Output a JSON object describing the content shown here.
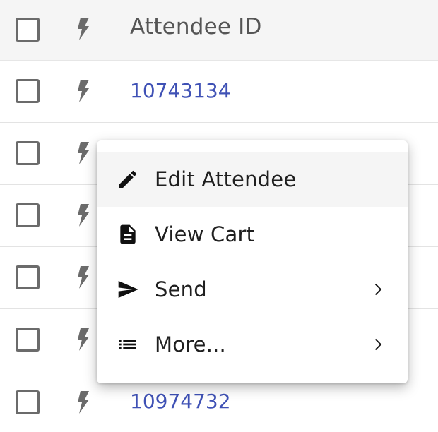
{
  "table": {
    "header": {
      "column_title": "Attendee ID"
    },
    "rows": [
      {
        "attendee_id": "10743134"
      },
      {
        "attendee_id": ""
      },
      {
        "attendee_id": ""
      },
      {
        "attendee_id": ""
      },
      {
        "attendee_id": ""
      },
      {
        "attendee_id": "10974732"
      }
    ]
  },
  "context_menu": {
    "items": [
      {
        "label": "Edit Attendee",
        "icon": "pencil-icon",
        "has_submenu": false
      },
      {
        "label": "View Cart",
        "icon": "document-icon",
        "has_submenu": false
      },
      {
        "label": "Send",
        "icon": "send-icon",
        "has_submenu": true
      },
      {
        "label": "More...",
        "icon": "list-icon",
        "has_submenu": true
      }
    ]
  },
  "colors": {
    "link": "#3f51b5",
    "header_bg": "#f5f5f5",
    "hover_bg": "#f5f5f5"
  }
}
